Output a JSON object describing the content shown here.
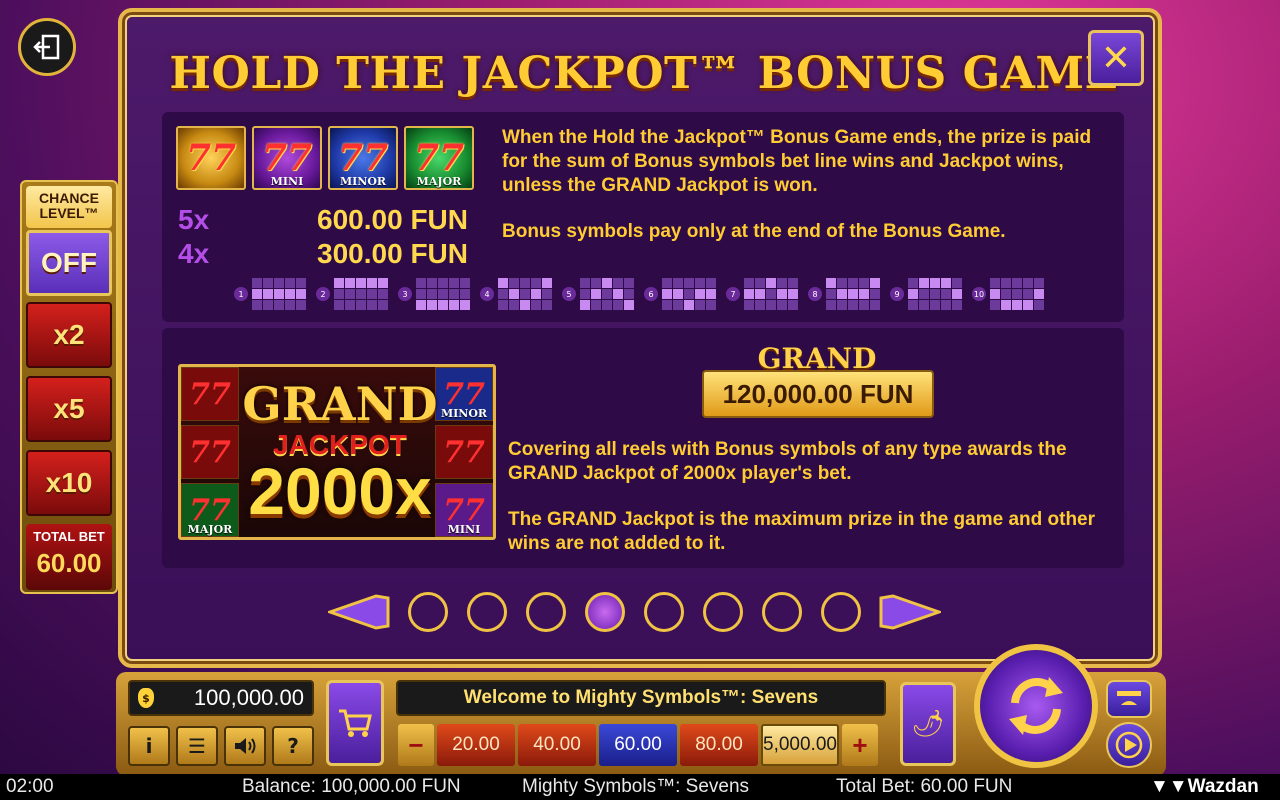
{
  "exit": {
    "icon": "exit-icon"
  },
  "chance": {
    "header": "CHANCE LEVEL™",
    "options": [
      {
        "label": "OFF",
        "selected": true
      },
      {
        "label": "x2",
        "selected": false
      },
      {
        "label": "x5",
        "selected": false
      },
      {
        "label": "x10",
        "selected": false
      }
    ],
    "total_bet_label": "TOTAL BET",
    "total_bet_value": "60.00"
  },
  "paytable": {
    "title": "HOLD THE JACKPOT™ BONUS GAME",
    "close_label": "✕",
    "symbols": [
      {
        "label": "",
        "style": "red"
      },
      {
        "label": "MINI",
        "style": "purple"
      },
      {
        "label": "MINOR",
        "style": "blue"
      },
      {
        "label": "MAJOR",
        "style": "green"
      }
    ],
    "pays": [
      {
        "mult": "5x",
        "value": "600.00 FUN"
      },
      {
        "mult": "4x",
        "value": "300.00 FUN"
      }
    ],
    "text1": "When the Hold the Jackpot™ Bonus Game ends, the prize is paid for the sum of Bonus symbols bet line wins and Jackpot wins, unless the GRAND Jackpot is won.",
    "text2": "Bonus symbols pay only at the end of the Bonus Game.",
    "lines": [
      "1",
      "2",
      "3",
      "4",
      "5",
      "6",
      "7",
      "8",
      "9",
      "10"
    ],
    "grand_art": {
      "title": "GRAND",
      "subtitle": "JACKPOT",
      "multiplier": "2000x",
      "tile_mini": "MINI",
      "tile_minor": "MINOR",
      "tile_major": "MAJOR"
    },
    "grand_banner_title": "GRAND",
    "grand_banner_value": "120,000.00 FUN",
    "text3": "Covering all reels with Bonus symbols of any type awards the GRAND Jackpot of 2000x player's bet.",
    "text4": "The GRAND Jackpot is the maximum prize in the game and other wins are not added to it.",
    "pages": 8,
    "active_page": 4
  },
  "controls": {
    "balance": "100,000.00",
    "message": "Welcome to Mighty Symbols™: Sevens",
    "info_label": "i",
    "menu_label": "☰",
    "sound_label": "🔊",
    "help_label": "?",
    "bet_minus": "−",
    "bet_plus": "+",
    "bets": [
      "20.00",
      "40.00",
      "60.00",
      "80.00",
      "5,000.00"
    ],
    "selected_bet": "60.00"
  },
  "status": {
    "time": "02:00",
    "balance": "Balance: 100,000.00 FUN",
    "game": "Mighty Symbols™: Sevens",
    "total_bet": "Total Bet: 60.00 FUN",
    "brand": "Wazdan"
  },
  "colors": {
    "gold": "#ffcc33",
    "purple": "#3a0f57",
    "accent_purple": "#b44ee8"
  }
}
